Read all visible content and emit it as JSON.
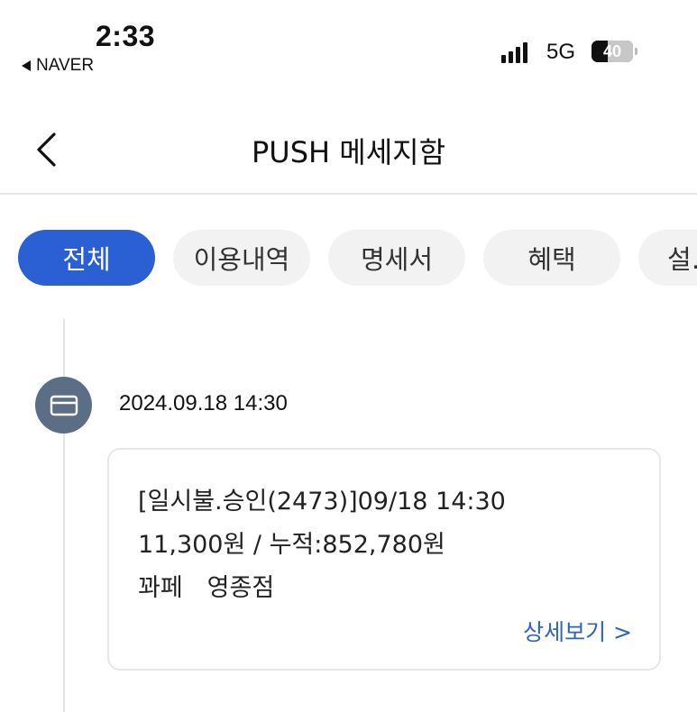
{
  "status_bar": {
    "time": "2:33",
    "back_app": "NAVER",
    "network": "5G",
    "battery_level": "40",
    "battery_fraction": 0.4,
    "signal_bars": 4
  },
  "header": {
    "title": "PUSH 메세지함"
  },
  "tabs": [
    {
      "label": "전체",
      "active": true
    },
    {
      "label": "이용내역",
      "active": false
    },
    {
      "label": "명세서",
      "active": false
    },
    {
      "label": "혜택",
      "active": false
    },
    {
      "label": "설…",
      "active": false
    }
  ],
  "entries": [
    {
      "icon": "card-icon",
      "date": "2024.09.18 14:30",
      "lines": [
        "[일시불.승인(2473)]09/18 14:30",
        "11,300원 / 누적:852,780원",
        "꽈페　영종점"
      ],
      "detail_link": "상세보기 >"
    }
  ],
  "colors": {
    "accent": "#2b5fd4",
    "tab_bg": "#f2f2f3",
    "timeline_dot": "#5b6e85",
    "link": "#2e63c4"
  }
}
